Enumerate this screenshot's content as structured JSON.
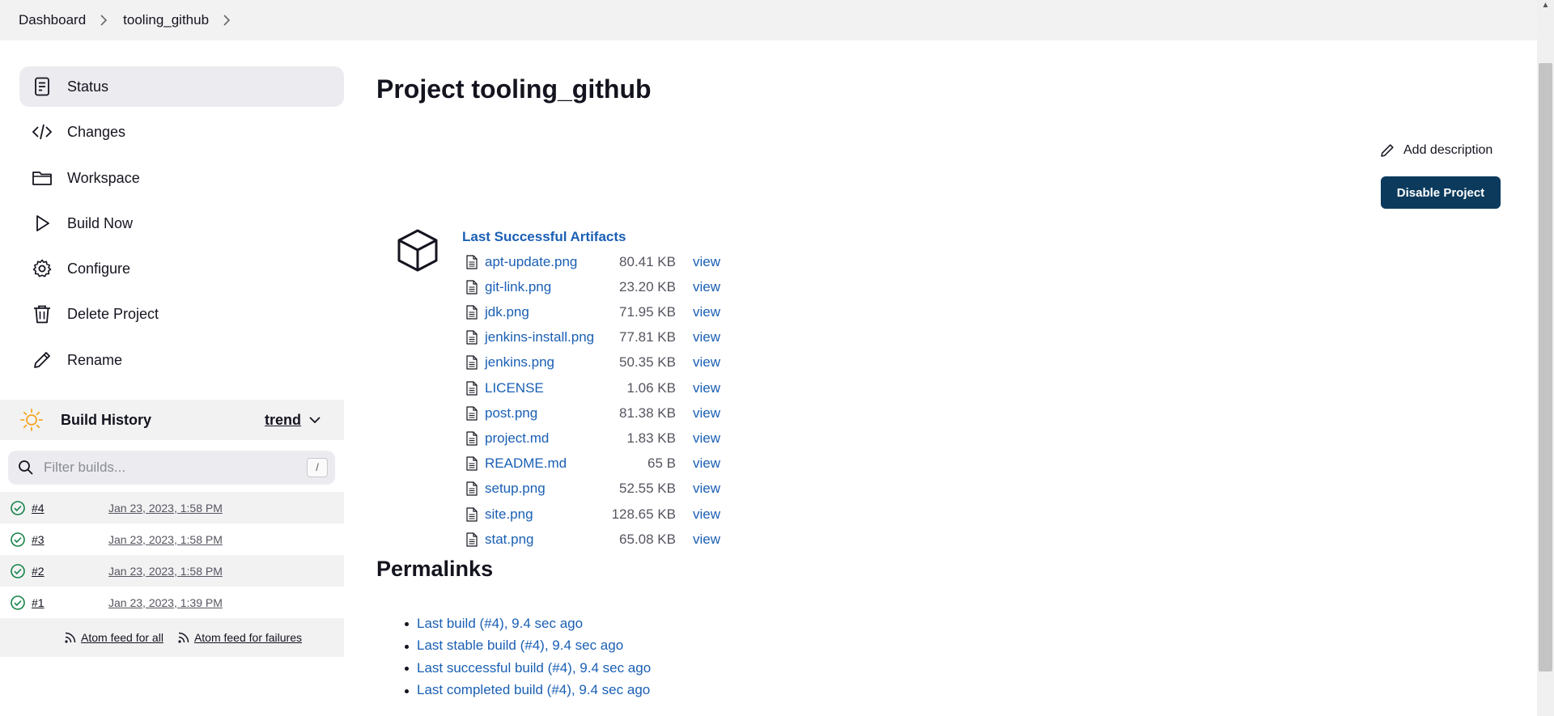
{
  "breadcrumb": {
    "items": [
      "Dashboard",
      "tooling_github"
    ]
  },
  "sidebar": {
    "tasks": [
      {
        "label": "Status",
        "icon": "status-icon"
      },
      {
        "label": "Changes",
        "icon": "code-icon"
      },
      {
        "label": "Workspace",
        "icon": "folder-icon"
      },
      {
        "label": "Build Now",
        "icon": "play-icon"
      },
      {
        "label": "Configure",
        "icon": "gear-icon"
      },
      {
        "label": "Delete Project",
        "icon": "trash-icon"
      },
      {
        "label": "Rename",
        "icon": "pencil-icon"
      }
    ],
    "active_task": "Status"
  },
  "build_history": {
    "title": "Build History",
    "trend_label": "trend",
    "filter_placeholder": "Filter builds...",
    "shortcut": "/",
    "builds": [
      {
        "number": "#4",
        "date": "Jan 23, 2023, 1:58 PM",
        "status": "success"
      },
      {
        "number": "#3",
        "date": "Jan 23, 2023, 1:58 PM",
        "status": "success"
      },
      {
        "number": "#2",
        "date": "Jan 23, 2023, 1:58 PM",
        "status": "success"
      },
      {
        "number": "#1",
        "date": "Jan 23, 2023, 1:39 PM",
        "status": "success"
      }
    ],
    "feeds": {
      "all": "Atom feed for all",
      "failures": "Atom feed for failures"
    }
  },
  "main": {
    "title": "Project tooling_github",
    "add_description": "Add description",
    "disable_button": "Disable Project",
    "artifacts_heading": "Last Successful Artifacts",
    "artifacts": [
      {
        "name": "apt-update.png",
        "size": "80.41 KB",
        "action": "view"
      },
      {
        "name": "git-link.png",
        "size": "23.20 KB",
        "action": "view"
      },
      {
        "name": "jdk.png",
        "size": "71.95 KB",
        "action": "view"
      },
      {
        "name": "jenkins-install.png",
        "size": "77.81 KB",
        "action": "view"
      },
      {
        "name": "jenkins.png",
        "size": "50.35 KB",
        "action": "view"
      },
      {
        "name": "LICENSE",
        "size": "1.06 KB",
        "action": "view"
      },
      {
        "name": "post.png",
        "size": "81.38 KB",
        "action": "view"
      },
      {
        "name": "project.md",
        "size": "1.83 KB",
        "action": "view"
      },
      {
        "name": "README.md",
        "size": "65 B",
        "action": "view"
      },
      {
        "name": "setup.png",
        "size": "52.55 KB",
        "action": "view"
      },
      {
        "name": "site.png",
        "size": "128.65 KB",
        "action": "view"
      },
      {
        "name": "stat.png",
        "size": "65.08 KB",
        "action": "view"
      }
    ],
    "permalinks_title": "Permalinks",
    "permalinks": [
      "Last build (#4), 9.4 sec ago",
      "Last stable build (#4), 9.4 sec ago",
      "Last successful build (#4), 9.4 sec ago",
      "Last completed build (#4), 9.4 sec ago"
    ]
  },
  "colors": {
    "link": "#1a5fb4",
    "primary_button": "#0b3a5c",
    "success": "#138347",
    "sun": "#f5a623"
  }
}
